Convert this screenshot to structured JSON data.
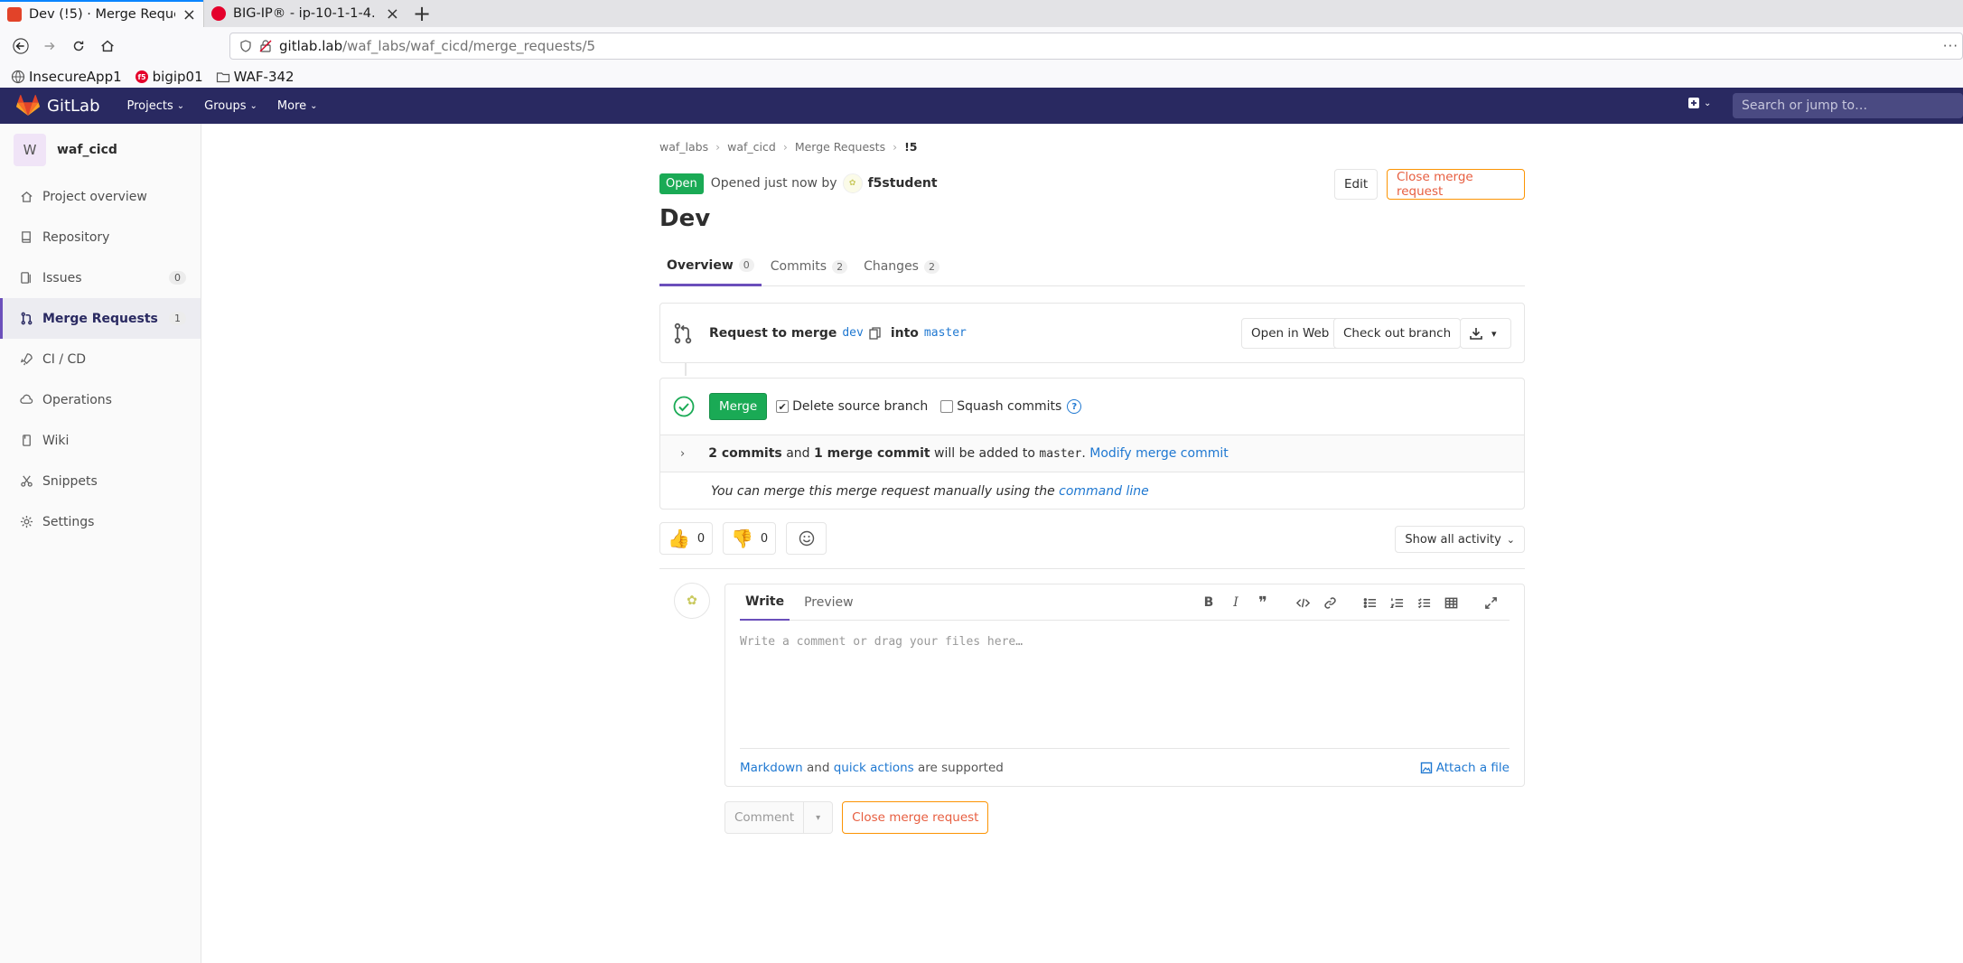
{
  "browser": {
    "tabs": [
      {
        "title": "Dev (!5) · Merge Reque",
        "close": "×",
        "favicon_color": "#e24329"
      },
      {
        "title": "BIG-IP® - ip-10-1-1-4.",
        "close": "×",
        "favicon_color": "#e4002b"
      }
    ],
    "newtab": "+",
    "url_host": "gitlab.lab",
    "url_path": "/waf_labs/waf_cicd/merge_requests/5",
    "url_more": "···",
    "bookmarks": [
      "InsecureApp1",
      "bigip01",
      "WAF-342"
    ]
  },
  "header": {
    "brand": "GitLab",
    "menu": [
      {
        "label": "Projects",
        "caret": "⌄"
      },
      {
        "label": "Groups",
        "caret": "⌄"
      },
      {
        "label": "More",
        "caret": "⌄"
      }
    ],
    "plus_caret": "⌄",
    "search_placeholder": "Search or jump to…",
    "bg": "#292961"
  },
  "sidebar": {
    "project_initial": "W",
    "project_name": "waf_cicd",
    "items": [
      {
        "label": "Project overview",
        "icon": "home-icon"
      },
      {
        "label": "Repository",
        "icon": "book-icon"
      },
      {
        "label": "Issues",
        "icon": "issues-icon",
        "badge": "0"
      },
      {
        "label": "Merge Requests",
        "icon": "merge-request-icon",
        "badge": "1",
        "active": true
      },
      {
        "label": "CI / CD",
        "icon": "rocket-icon"
      },
      {
        "label": "Operations",
        "icon": "cloud-gear-icon"
      },
      {
        "label": "Wiki",
        "icon": "wiki-icon"
      },
      {
        "label": "Snippets",
        "icon": "scissors-icon"
      },
      {
        "label": "Settings",
        "icon": "gear-icon"
      }
    ]
  },
  "breadcrumb": {
    "items": [
      "waf_labs",
      "waf_cicd",
      "Merge Requests"
    ],
    "current": "!5",
    "sep": "›"
  },
  "mr": {
    "status": "Open",
    "opened_text": "Opened just now by",
    "author": "f5student",
    "edit_label": "Edit",
    "close_label": "Close merge request",
    "title": "Dev",
    "tabs": [
      {
        "label": "Overview",
        "count": "0"
      },
      {
        "label": "Commits",
        "count": "2"
      },
      {
        "label": "Changes",
        "count": "2"
      }
    ]
  },
  "request": {
    "prefix": "Request to merge",
    "source": "dev",
    "into": "into",
    "target": "master",
    "web_ide": "Open in Web IDE",
    "checkout": "Check out branch",
    "download_caret": "▾"
  },
  "merge": {
    "merge_label": "Merge",
    "delete_source": "Delete source branch",
    "squash": "Squash commits",
    "help": "?",
    "commits_bold": "2 commits",
    "and": "and",
    "merge_commit_bold": "1 merge commit",
    "will_be_added": "will be added to",
    "target": "master",
    "period": ".",
    "modify": "Modify merge commit",
    "chevron": "›",
    "manual_text": "You can merge this merge request manually using the",
    "command_line": "command line"
  },
  "reactions": {
    "thumbs_up": "👍",
    "thumbs_up_count": "0",
    "thumbs_down": "👎",
    "thumbs_down_count": "0",
    "show_activity": "Show all activity",
    "activity_caret": "⌄"
  },
  "comment": {
    "write": "Write",
    "preview": "Preview",
    "placeholder": "Write a comment or drag your files here…",
    "markdown": "Markdown",
    "and": "and",
    "quick_actions": "quick actions",
    "supported": "are supported",
    "attach": "Attach a file",
    "comment_btn": "Comment",
    "comment_caret": "▾",
    "close_btn": "Close merge request",
    "toolbar": {
      "bold": "B",
      "italic": "I",
      "quote": "❞"
    }
  }
}
